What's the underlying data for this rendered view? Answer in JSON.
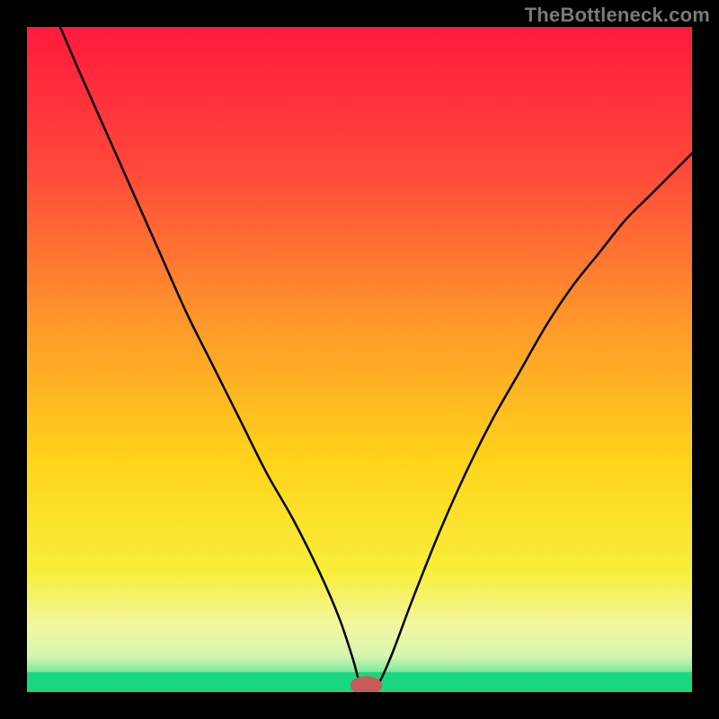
{
  "attribution": "TheBottleneck.com",
  "chart_data": {
    "type": "line",
    "title": "",
    "xlabel": "",
    "ylabel": "",
    "xlim": [
      0,
      100
    ],
    "ylim": [
      0,
      100
    ],
    "grid": false,
    "legend": false,
    "background_gradient_stops": [
      {
        "offset": 0.0,
        "color": "#ff1a3c"
      },
      {
        "offset": 0.22,
        "color": "#ff4a3a"
      },
      {
        "offset": 0.45,
        "color": "#ff9a2a"
      },
      {
        "offset": 0.65,
        "color": "#ffd31a"
      },
      {
        "offset": 0.82,
        "color": "#f7ef3a"
      },
      {
        "offset": 0.9,
        "color": "#f3f6a0"
      },
      {
        "offset": 0.945,
        "color": "#d8f5b0"
      },
      {
        "offset": 0.975,
        "color": "#6be69a"
      },
      {
        "offset": 1.0,
        "color": "#18d77f"
      }
    ],
    "green_floor_band": {
      "y_from": 0,
      "y_to": 3,
      "color": "#18d77f"
    },
    "series": [
      {
        "name": "bottleneck-curve",
        "stroke": "#000000",
        "stroke_width": 2.5,
        "x": [
          5,
          8,
          12,
          16,
          20,
          24,
          28,
          32,
          36,
          40,
          44,
          47,
          49,
          50,
          51,
          52,
          53,
          55,
          58,
          62,
          66,
          70,
          74,
          78,
          82,
          86,
          90,
          94,
          98,
          100
        ],
        "values": [
          100,
          93,
          84,
          75,
          66,
          57,
          49,
          41,
          33,
          26,
          18,
          11,
          5,
          1.5,
          0.5,
          0.5,
          1.5,
          6,
          14,
          24,
          33,
          41,
          48,
          55,
          61,
          66,
          71,
          75,
          79,
          81
        ]
      }
    ],
    "marker": {
      "name": "optimal-point",
      "x": 51,
      "y": 1,
      "rx": 2.4,
      "ry": 1.4,
      "fill": "#c85a58"
    }
  }
}
